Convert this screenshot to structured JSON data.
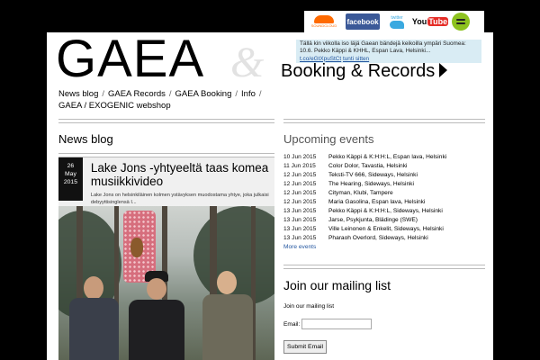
{
  "social": {
    "soundcloud_label": "SOUNDCLOUD",
    "facebook_label": "facebook",
    "twitter_label": "twitter",
    "youtube_you": "You",
    "youtube_tube": "Tube"
  },
  "header": {
    "logo": "GAEA",
    "ampersand": "&",
    "booking_link": "Booking & Records",
    "tweet": {
      "text": "Tällä kin viikolla iso läjä Gaean bändejä keikoilla ympäri Suomea: 10.6. Pekko Käppi & KHHL, Espan Lava, Helsinki...",
      "link": "t.co/eGtXpuStCt",
      "time": "tunti sitten"
    }
  },
  "nav": {
    "items": [
      "News blog",
      "GAEA Records",
      "GAEA Booking",
      "Info",
      "GAEA / EXOGENIC webshop"
    ],
    "separator": "/"
  },
  "news": {
    "title": "News blog",
    "post": {
      "day": "26",
      "month": "May",
      "year": "2015",
      "title": "Lake Jons -yhtyeeltä taas komea musiikkivideo",
      "excerpt": "Lake Jons on helsinkiläinen kolmen ystävyksen muodostama yhtye, joka julkaisi debyyttisinglensä I..."
    }
  },
  "upcoming": {
    "title": "Upcoming events",
    "events": [
      {
        "date": "10 Jun 2015",
        "name": "Pekko Käppi & K:H:H:L, Espan lava, Helsinki"
      },
      {
        "date": "11 Jun 2015",
        "name": "Color Dolor, Tavastia, Helsinki"
      },
      {
        "date": "12 Jun 2015",
        "name": "Teksti-TV 666, Sideways, Helsinki"
      },
      {
        "date": "12 Jun 2015",
        "name": "The Hearing, Sideways, Helsinki"
      },
      {
        "date": "12 Jun 2015",
        "name": "Cityman, Klubi, Tampere"
      },
      {
        "date": "12 Jun 2015",
        "name": "Maria Gasolina, Espan lava, Helsinki"
      },
      {
        "date": "13 Jun 2015",
        "name": "Pekko Käppi & K:H:H:L, Sideways, Helsinki"
      },
      {
        "date": "13 Jun 2015",
        "name": "Jarse, Psykjunta, Blädinge (SWE)"
      },
      {
        "date": "13 Jun 2015",
        "name": "Ville Leinonen & Enkelit, Sideways, Helsinki"
      },
      {
        "date": "13 Jun 2015",
        "name": "Pharaoh Overlord, Sideways, Helsinki"
      }
    ],
    "more_label": "More events"
  },
  "mailing": {
    "title": "Join our mailing list",
    "text": "Join our mailing list",
    "email_label": "Email:",
    "email_value": "",
    "submit_label": "Submit Email"
  }
}
